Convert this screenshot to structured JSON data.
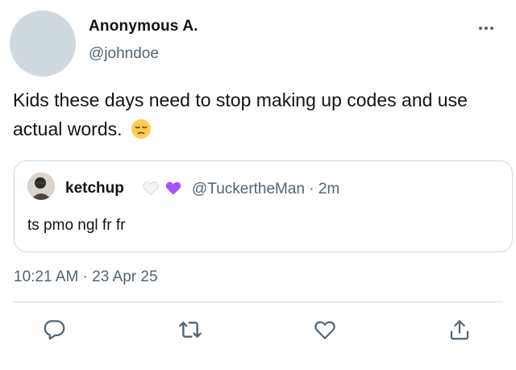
{
  "author": {
    "name": "Anonymous A.",
    "handle": "@johndoe"
  },
  "more_icon": "ellipsis-icon",
  "tweet": {
    "text": "Kids these days need to stop making up codes and use actual words.",
    "emoji": "pensive-face-emoji"
  },
  "quote": {
    "name": "ketchup",
    "badges": [
      "white-heart-emoji",
      "purple-heart-emoji"
    ],
    "handle_time": "@TuckertheMan · 2m",
    "text": "ts pmo ngl fr fr"
  },
  "timestamp": "10:21 AM · 23 Apr 25",
  "actions": [
    "reply-icon",
    "retweet-icon",
    "like-icon",
    "share-icon"
  ],
  "colors": {
    "text": "#0f1419",
    "secondary": "#536471",
    "border": "#cfd9de",
    "purple_heart": "#a855f7"
  }
}
